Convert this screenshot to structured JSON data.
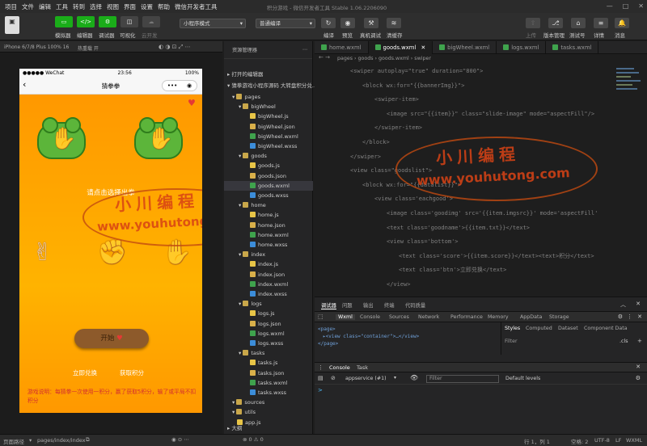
{
  "menu": [
    "项目",
    "文件",
    "编辑",
    "工具",
    "转到",
    "选择",
    "视图",
    "界面",
    "设置",
    "帮助",
    "微信开发者工具"
  ],
  "window_title": "积分游戏 - 微信开发者工具 Stable 1.06.2206090",
  "toolbar": {
    "simulator": "模拟器",
    "editor": "编辑器",
    "debugger": "调试器",
    "visual": "可视化",
    "cloud": "云开发",
    "mode": "小程序模式",
    "compile": "普通编译",
    "compile_btn": "编译",
    "preview": "预览",
    "real_debug": "真机调试",
    "clear_cache": "清缓存",
    "upload": "上传",
    "version": "版本管理",
    "test_account": "测试号",
    "details": "详情",
    "messages": "消息"
  },
  "sim": {
    "device": "iPhone 6/7/8 Plus 100% 16",
    "hot_reload": "热重载 开"
  },
  "phone": {
    "carrier": "●●●●● WeChat",
    "wifi_icon": "wifi-icon",
    "time": "23:56",
    "battery": "100%",
    "title": "猜拳拳",
    "hint": "请点击选择出拳",
    "start": "开始",
    "redeem": "立即兑换",
    "get_points": "获取积分",
    "desc": "游戏说明：每猜拳一次使用一积分，赢了获取5积分，输了或平局不扣积分"
  },
  "watermark": {
    "cn": "小川编程",
    "url": "www.youhutong.com"
  },
  "explorer": {
    "title": "资源管理器",
    "open_editors": "打开的编辑器",
    "project": "猜拳游戏小程序源码 大转盘积分兑...",
    "tree": [
      {
        "name": "pages",
        "depth": 1,
        "type": "folder"
      },
      {
        "name": "bigWheel",
        "depth": 2,
        "type": "folder"
      },
      {
        "name": "bigWheel.js",
        "depth": 3,
        "type": "js"
      },
      {
        "name": "bigWheel.json",
        "depth": 3,
        "type": "json"
      },
      {
        "name": "bigWheel.wxml",
        "depth": 3,
        "type": "wxml"
      },
      {
        "name": "bigWheel.wxss",
        "depth": 3,
        "type": "wxss"
      },
      {
        "name": "goods",
        "depth": 2,
        "type": "folder"
      },
      {
        "name": "goods.js",
        "depth": 3,
        "type": "js"
      },
      {
        "name": "goods.json",
        "depth": 3,
        "type": "json"
      },
      {
        "name": "goods.wxml",
        "depth": 3,
        "type": "wxml",
        "selected": true
      },
      {
        "name": "goods.wxss",
        "depth": 3,
        "type": "wxss"
      },
      {
        "name": "home",
        "depth": 2,
        "type": "folder"
      },
      {
        "name": "home.js",
        "depth": 3,
        "type": "js"
      },
      {
        "name": "home.json",
        "depth": 3,
        "type": "json"
      },
      {
        "name": "home.wxml",
        "depth": 3,
        "type": "wxml"
      },
      {
        "name": "home.wxss",
        "depth": 3,
        "type": "wxss"
      },
      {
        "name": "index",
        "depth": 2,
        "type": "folder"
      },
      {
        "name": "index.js",
        "depth": 3,
        "type": "js"
      },
      {
        "name": "index.json",
        "depth": 3,
        "type": "json"
      },
      {
        "name": "index.wxml",
        "depth": 3,
        "type": "wxml"
      },
      {
        "name": "index.wxss",
        "depth": 3,
        "type": "wxss"
      },
      {
        "name": "logs",
        "depth": 2,
        "type": "folder"
      },
      {
        "name": "logs.js",
        "depth": 3,
        "type": "js"
      },
      {
        "name": "logs.json",
        "depth": 3,
        "type": "json"
      },
      {
        "name": "logs.wxml",
        "depth": 3,
        "type": "wxml"
      },
      {
        "name": "logs.wxss",
        "depth": 3,
        "type": "wxss"
      },
      {
        "name": "tasks",
        "depth": 2,
        "type": "folder"
      },
      {
        "name": "tasks.js",
        "depth": 3,
        "type": "js"
      },
      {
        "name": "tasks.json",
        "depth": 3,
        "type": "json"
      },
      {
        "name": "tasks.wxml",
        "depth": 3,
        "type": "wxml"
      },
      {
        "name": "tasks.wxss",
        "depth": 3,
        "type": "wxss"
      },
      {
        "name": "sources",
        "depth": 1,
        "type": "folder"
      },
      {
        "name": "utils",
        "depth": 1,
        "type": "folder"
      },
      {
        "name": "app.js",
        "depth": 1,
        "type": "js"
      }
    ],
    "outline": "大纲"
  },
  "tabs": [
    "home.wxml",
    "goods.wxml",
    "bigWheel.wxml",
    "logs.wxml",
    "tasks.wxml"
  ],
  "breadcrumb": "pages › goods › goods.wxml › swiper",
  "code": [
    {
      "ind": 0,
      "t": "<swiper autoplay=\"true\" duration=\"800\">"
    },
    {
      "ind": 1,
      "t": "<block wx:for=\"{{bannerImg}}\">"
    },
    {
      "ind": 2,
      "t": "<swiper-item>"
    },
    {
      "ind": 3,
      "t": "<image src=\"{{item}}\" class=\"slide-image\" mode=\"aspectFill\"/>"
    },
    {
      "ind": 2,
      "t": "</swiper-item>"
    },
    {
      "ind": 1,
      "t": "</block>"
    },
    {
      "ind": 0,
      "t": "</swiper>"
    },
    {
      "ind": 0,
      "t": "<view class=\"goodslist\">"
    },
    {
      "ind": 1,
      "t": "<block wx:for=\"{{datalist}}\">"
    },
    {
      "ind": 2,
      "t": "<view class='eachgood'>"
    },
    {
      "ind": 3,
      "t": "<image class='goodimg' src='{{item.imgsrc}}' mode='aspectFill'"
    },
    {
      "ind": 3,
      "t": "<text class='goodname'>{{item.txt}}</text>"
    },
    {
      "ind": 3,
      "t": "<view class='bottom'>"
    },
    {
      "ind": 4,
      "t": "<text class='score'>{{item.score}}</text><text>积分</text>"
    },
    {
      "ind": 4,
      "t": "<text class='btn'>立即兑换</text>"
    },
    {
      "ind": 3,
      "t": "</view>"
    }
  ],
  "devtools": {
    "tabs": [
      "调试器",
      "问题",
      "输出",
      "终端",
      "代码质量"
    ],
    "subtabs": [
      "Wxml",
      "Console",
      "Sources",
      "Network",
      "Performance",
      "Memory",
      "AppData",
      "Storage"
    ],
    "wxml": [
      "<page>",
      "▸<view class=\"container\">…</view>",
      "</page>"
    ],
    "styles_tabs": [
      "Styles",
      "Computed",
      "Dataset",
      "Component Data"
    ],
    "filter": "Filter",
    "cls": ".cls",
    "console_tabs": [
      "Console",
      "Task"
    ],
    "context": "appservice (#1)",
    "filter_ph": "Filter",
    "levels": "Default levels",
    "prompt": ">"
  },
  "statusbar": {
    "path_label": "页面路径",
    "path": "pages/index/index",
    "pos": "行 1，列 1",
    "spaces": "空格: 2",
    "enc": "UTF-8",
    "eol": "LF",
    "lang": "WXML"
  },
  "colors": {
    "accent": "#1aad19",
    "game_bg": "#ffa000",
    "watermark": "#d84315"
  }
}
